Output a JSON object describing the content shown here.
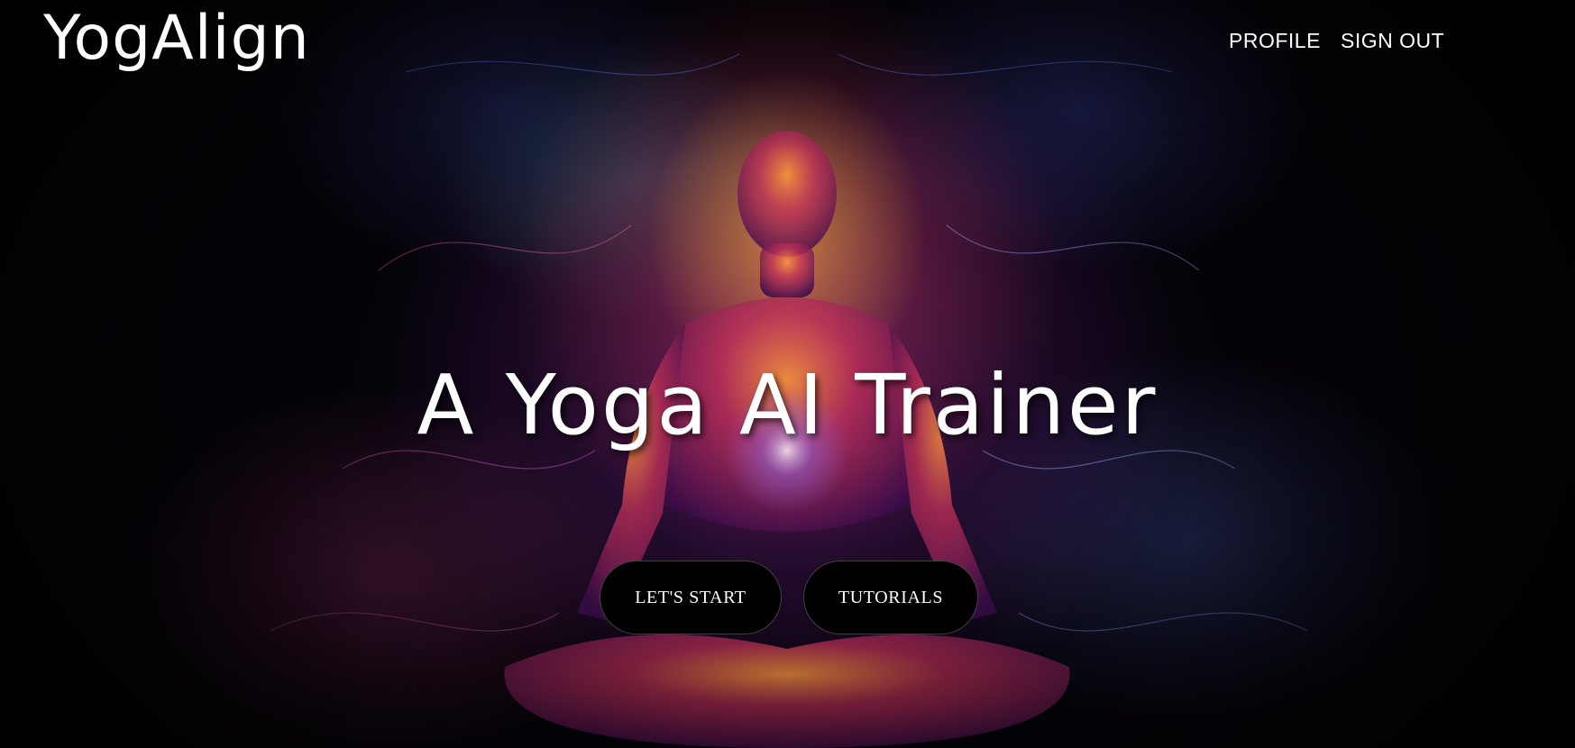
{
  "brand": {
    "name": "YogAlign"
  },
  "nav": {
    "profile_label": "PROFILE",
    "signout_label": "SIGN OUT"
  },
  "hero": {
    "title": "A Yoga AI Trainer",
    "background_image": "meditating-figure-with-aura",
    "start_button_label": "LET'S START",
    "tutorials_button_label": "TUTORIALS"
  },
  "colors": {
    "text": "#ffffff",
    "button_bg": "#000000",
    "page_bg": "#05030a"
  }
}
